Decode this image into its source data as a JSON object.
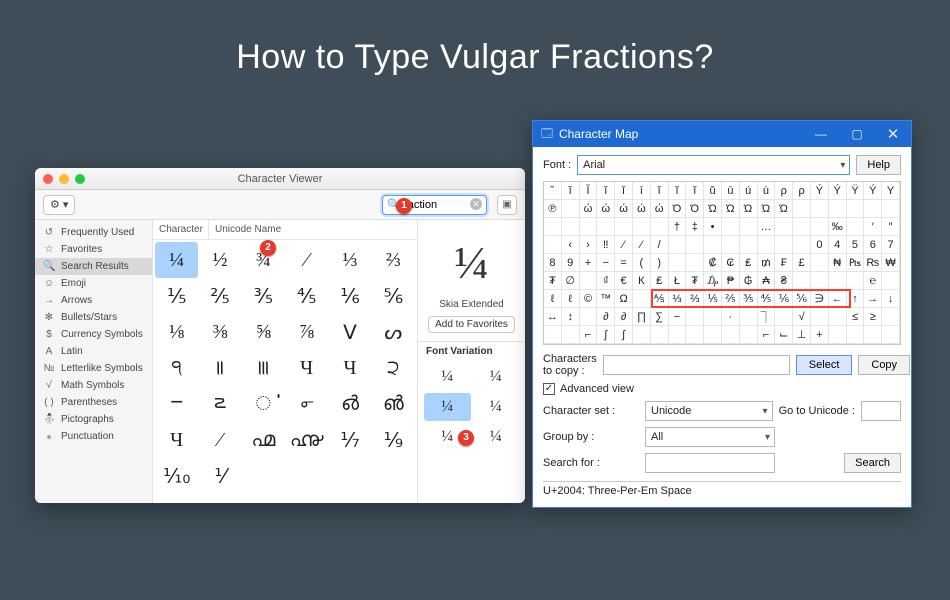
{
  "page": {
    "title": "How to Type Vulgar Fractions?"
  },
  "callouts": [
    "1",
    "2",
    "3"
  ],
  "mac": {
    "window_title": "Character Viewer",
    "gear_label": "⚙",
    "search_value": "fraction",
    "sidebar": [
      {
        "icon": "↺",
        "label": "Frequently Used"
      },
      {
        "icon": "☆",
        "label": "Favorites"
      },
      {
        "icon": "🔍",
        "label": "Search Results"
      },
      {
        "icon": "☺",
        "label": "Emoji"
      },
      {
        "icon": "→",
        "label": "Arrows"
      },
      {
        "icon": "✻",
        "label": "Bullets/Stars"
      },
      {
        "icon": "$",
        "label": "Currency Symbols"
      },
      {
        "icon": "A",
        "label": "Latin"
      },
      {
        "icon": "№",
        "label": "Letterlike Symbols"
      },
      {
        "icon": "√",
        "label": "Math Symbols"
      },
      {
        "icon": "( )",
        "label": "Parentheses"
      },
      {
        "icon": "⛄",
        "label": "Pictographs"
      },
      {
        "icon": "⁎",
        "label": "Punctuation"
      }
    ],
    "selected_sidebar": 2,
    "col_character": "Character",
    "col_unicode": "Unicode Name",
    "grid": [
      "¼",
      "½",
      "¾",
      "⁄",
      "⅓",
      "⅔",
      "⅕",
      "⅖",
      "⅗",
      "⅘",
      "⅙",
      "⅚",
      "⅛",
      "⅜",
      "⅝",
      "⅞",
      "Ⅴ",
      "ᔕ",
      "੧",
      "꠱",
      "꠲",
      "Ч",
      "Ч",
      "੨",
      "౼",
      "౽",
      "ൎ",
      "൳",
      "൴",
      "൵",
      "Ч",
      "⁄",
      "൶",
      "൷",
      "⅐",
      "⅑",
      "⅒",
      "⅟",
      "",
      ""
    ],
    "selected_idx": 0,
    "preview_char": "¼",
    "preview_font": "Skia Extended",
    "add_favorites": "Add to Favorites",
    "font_variation_header": "Font Variation",
    "variations": [
      "¼",
      "¼",
      "¼",
      "¼",
      "¼",
      "¼"
    ],
    "variation_selected": 2
  },
  "win": {
    "title": "Character Map",
    "font_label": "Font :",
    "font_value": "Arial",
    "help": "Help",
    "grid": [
      "˘",
      "ĭ",
      "Ĭ",
      "ĭ",
      "ĭ",
      "ī",
      "ĭ",
      "ĭ",
      "ĭ",
      "ŭ",
      "ū",
      "ú",
      "ù",
      "ρ",
      "ρ",
      "Ý",
      "Ý",
      "Ÿ",
      "Ý",
      "Y",
      "℗",
      "",
      "ώ",
      "ώ",
      "ώ",
      "ώ",
      "ώ",
      "Ό",
      "Ό",
      "Ώ",
      "Ώ",
      "Ώ",
      "Ώ",
      "Ώ",
      "",
      "",
      "",
      "",
      "",
      "",
      "",
      "",
      "",
      "",
      "",
      "",
      "",
      "†",
      "‡",
      "•",
      "",
      "",
      "…",
      "",
      "",
      "",
      "‰",
      "",
      "′",
      "″",
      "",
      "‹",
      "›",
      "‼",
      "⁄",
      "⁄",
      "/",
      "",
      "",
      "",
      "",
      "",
      "",
      "",
      "",
      "0",
      "4",
      "5",
      "6",
      "7",
      "8",
      "9",
      "+",
      "−",
      "=",
      "(",
      ")",
      "",
      "",
      "₡",
      "₢",
      "₤",
      "₥",
      "₣",
      "£",
      "",
      "₦",
      "₧",
      "₨",
      "₩",
      "₮",
      "∅",
      "",
      "₫",
      "€",
      "К",
      "₤",
      "Ł",
      "₮",
      "₯",
      "₱",
      "₲",
      "₳",
      "₴",
      "",
      "",
      "",
      "",
      "℮",
      "",
      "ℓ",
      "ℓ",
      "©",
      "™",
      "Ω",
      "",
      "⅍",
      "⅓",
      "⅔",
      "⅕",
      "⅖",
      "⅗",
      "⅘",
      "⅙",
      "⅚",
      "∋",
      "←",
      "↑",
      "→",
      "↓",
      "↔",
      "↕",
      "",
      "∂",
      "∂",
      "∏",
      "∑",
      "−",
      "",
      "",
      "∙",
      "",
      "⏋",
      "",
      "√",
      "",
      "",
      "≤",
      "≥",
      "",
      "",
      "",
      "⌐",
      "∫",
      "∫",
      "",
      "",
      "",
      "",
      "",
      "",
      "",
      "⌐",
      "⌙",
      "⊥",
      "+",
      "",
      "",
      "",
      ""
    ],
    "copy_label": "Characters to copy :",
    "copy_value": "",
    "select": "Select",
    "copy": "Copy",
    "advanced": "Advanced view",
    "charset_label": "Character set :",
    "charset_value": "Unicode",
    "goto_label": "Go to Unicode :",
    "goto_value": "",
    "group_label": "Group by :",
    "group_value": "All",
    "search_label": "Search for :",
    "search_value": "",
    "search_btn": "Search",
    "status": "U+2004: Three-Per-Em Space"
  }
}
